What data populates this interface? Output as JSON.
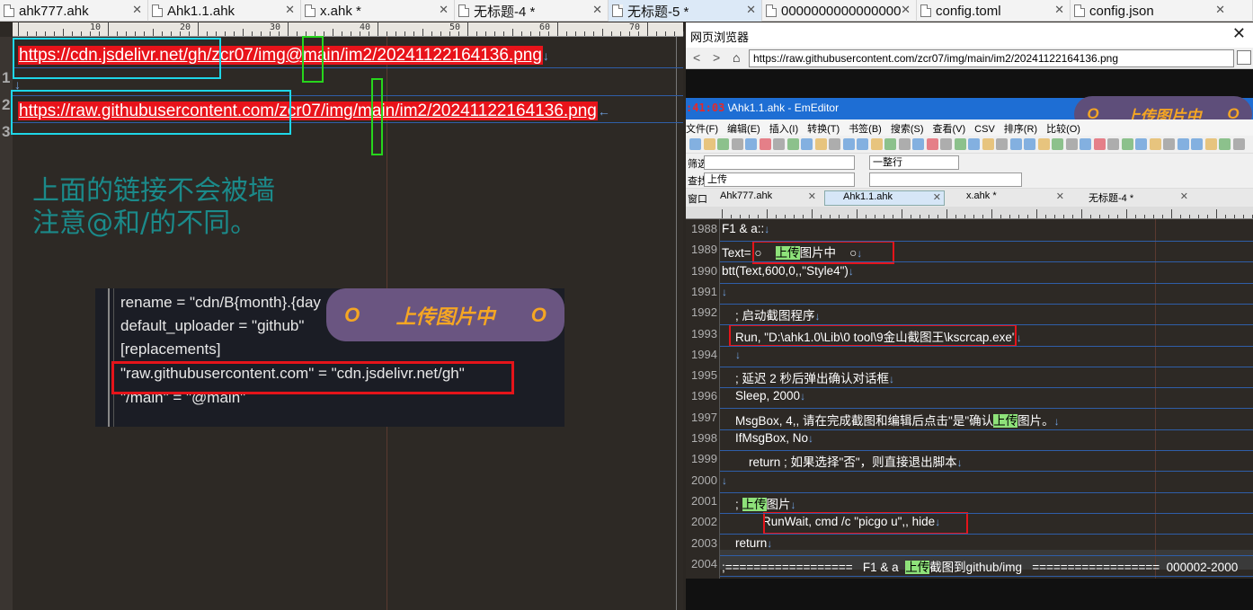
{
  "tabs": [
    {
      "label": "ahk777.ahk",
      "active": false
    },
    {
      "label": "Ahk1.1.ahk",
      "active": false
    },
    {
      "label": "x.ahk *",
      "active": false
    },
    {
      "label": "无标题-4 *",
      "active": false
    },
    {
      "label": "无标题-5 *",
      "active": true
    },
    {
      "label": "0000000000000000",
      "active": false
    },
    {
      "label": "config.toml",
      "active": false
    },
    {
      "label": "config.json",
      "active": false
    }
  ],
  "ruler": {
    "labels": [
      "10",
      "20",
      "30",
      "40",
      "50",
      "60",
      "70",
      "80"
    ]
  },
  "editor": {
    "lines": [
      {
        "num": "1",
        "text": "https://cdn.jsdelivr.net/gh/zcr07/img@main/im2/20241122164136.png",
        "tail": "↓"
      },
      {
        "num": "2",
        "text": "",
        "tail": "↓"
      },
      {
        "num": "3",
        "text": "https://raw.githubusercontent.com/zcr07/img/main/im2/20241122164136.png",
        "tail": "←"
      }
    ],
    "note_line1": "上面的链接不会被墙",
    "note_line2": "注意@和/的不同。"
  },
  "panel": {
    "lines": [
      "rename = \"cdn/B{month}.{day",
      "default_uploader = \"github\"",
      "[replacements]",
      "\"raw.githubusercontent.com\" = \"cdn.jsdelivr.net/gh\"",
      "\"/main\" = \"@main\""
    ],
    "pill_text": "上传图片中",
    "pill_o": "O"
  },
  "browser": {
    "title": "网页浏览器",
    "close": "✕",
    "nav_back": "<",
    "nav_forward": ">",
    "nav_home": "⌂",
    "url": "https://raw.githubusercontent.com/zcr07/img/main/im2/20241122164136.png"
  },
  "emeditor": {
    "clock": ":41:03",
    "title": "\\Ahk1.1.ahk - EmEditor",
    "pill_text": "上传图片中",
    "pill_o": "O",
    "menu": [
      "文件(F)",
      "编辑(E)",
      "插入(I)",
      "转换(T)",
      "书签(B)",
      "搜索(S)",
      "查看(V)",
      "CSV",
      "排序(R)",
      "比较(O)"
    ],
    "filter_label": "筛选",
    "filter_mode": "一整行",
    "find_label": "查找",
    "find_value": "上传",
    "tabs": [
      "Ahk777.ahk",
      "Ahk1.1.ahk",
      "x.ahk *",
      "无标题-4 *"
    ],
    "tab_prefix": "窗口",
    "rows": [
      {
        "num": "1988",
        "pre": "F1 & a::",
        "hl": "",
        "post": "",
        "tail": "↓"
      },
      {
        "num": "1989",
        "pre": "Text= ○    ",
        "hl": "上传",
        "post": "图片中    ○",
        "tail": "↓"
      },
      {
        "num": "1990",
        "pre": "btt(Text,600,0,,\"Style4\")",
        "hl": "",
        "post": "",
        "tail": "↓"
      },
      {
        "num": "1991",
        "pre": "",
        "hl": "",
        "post": "",
        "tail": "↓"
      },
      {
        "num": "1992",
        "pre": "    ; 启动截图程序",
        "hl": "",
        "post": "",
        "tail": "↓"
      },
      {
        "num": "1993",
        "pre": "    Run, \"D:\\ahk1.0\\Lib\\0 tool\\9金山截图王\\kscrcap.exe\"",
        "hl": "",
        "post": "",
        "tail": "↓"
      },
      {
        "num": "1994",
        "pre": "    ",
        "hl": "",
        "post": "",
        "tail": "↓"
      },
      {
        "num": "1995",
        "pre": "    ; 延迟 2 秒后弹出确认对话框",
        "hl": "",
        "post": "",
        "tail": "↓"
      },
      {
        "num": "1996",
        "pre": "    Sleep, 2000",
        "hl": "",
        "post": "",
        "tail": "↓"
      },
      {
        "num": "1997",
        "pre": "    MsgBox, 4,, 请在完成截图和编辑后点击\"是\"确认",
        "hl": "上传",
        "post": "图片。",
        "tail": "↓"
      },
      {
        "num": "1998",
        "pre": "    IfMsgBox, No",
        "hl": "",
        "post": "",
        "tail": "↓"
      },
      {
        "num": "1999",
        "pre": "        return ; 如果选择\"否\"，则直接退出脚本",
        "hl": "",
        "post": "",
        "tail": "↓"
      },
      {
        "num": "2000",
        "pre": "",
        "hl": "",
        "post": "",
        "tail": "↓"
      },
      {
        "num": "2001",
        "pre": "    ; ",
        "hl": "上传",
        "post": "图片",
        "tail": "↓"
      },
      {
        "num": "2002",
        "pre": "            RunWait, cmd /c \"picgo u\",, hide",
        "hl": "",
        "post": "",
        "tail": "↓"
      },
      {
        "num": "2003",
        "pre": "    return",
        "hl": "",
        "post": "",
        "tail": "↓"
      },
      {
        "num": "2004",
        "pre": ";==================   F1 & a  ",
        "hl": "上传",
        "post": "截图到github/img   ==================  000002-2000",
        "tail": ""
      }
    ]
  },
  "colors": {
    "accent_red": "#e5141a",
    "cyan": "#1ed7e8",
    "green": "#27d51c",
    "highlight": "#8ee27a",
    "pill": "#6a5581",
    "pill_text": "#f5a623"
  }
}
